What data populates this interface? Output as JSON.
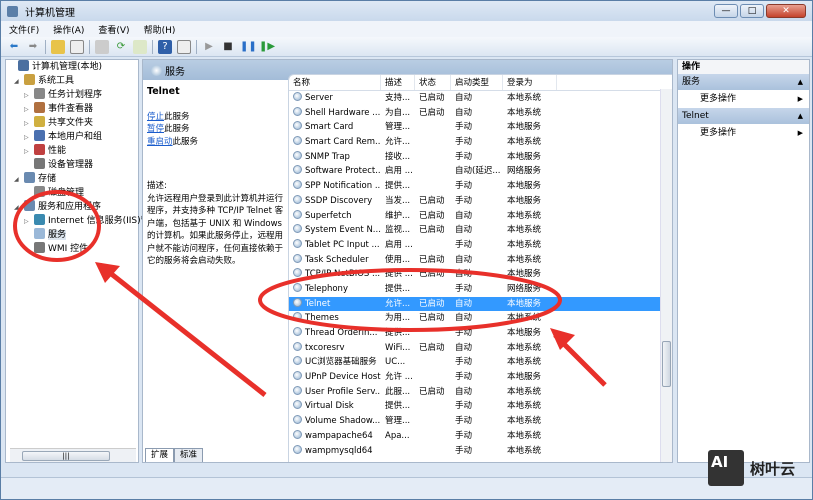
{
  "window": {
    "title": "计算机管理",
    "min": "—",
    "max": "□",
    "close": "✕"
  },
  "menu": [
    "文件(F)",
    "操作(A)",
    "查看(V)",
    "帮助(H)"
  ],
  "tree": [
    {
      "label": "计算机管理(本地)",
      "indent": 0,
      "arrow": ""
    },
    {
      "label": "系统工具",
      "indent": 1,
      "arrow": "◢"
    },
    {
      "label": "任务计划程序",
      "indent": 2,
      "arrow": "▷"
    },
    {
      "label": "事件查看器",
      "indent": 2,
      "arrow": "▷"
    },
    {
      "label": "共享文件夹",
      "indent": 2,
      "arrow": "▷"
    },
    {
      "label": "本地用户和组",
      "indent": 2,
      "arrow": "▷"
    },
    {
      "label": "性能",
      "indent": 2,
      "arrow": "▷"
    },
    {
      "label": "设备管理器",
      "indent": 2,
      "arrow": ""
    },
    {
      "label": "存储",
      "indent": 1,
      "arrow": "◢"
    },
    {
      "label": "磁盘管理",
      "indent": 2,
      "arrow": ""
    },
    {
      "label": "服务和应用程序",
      "indent": 1,
      "arrow": "◢"
    },
    {
      "label": "Internet 信息服务(IIS)管",
      "indent": 2,
      "arrow": "▷"
    },
    {
      "label": "服务",
      "indent": 2,
      "arrow": ""
    },
    {
      "label": "WMI 控件",
      "indent": 2,
      "arrow": ""
    }
  ],
  "middle": {
    "header": "服务",
    "selected_name": "Telnet",
    "links": [
      {
        "link": "停止",
        "rest": "此服务"
      },
      {
        "link": "暂停",
        "rest": "此服务"
      },
      {
        "link": "重启动",
        "rest": "此服务"
      }
    ],
    "desc_label": "描述:",
    "description": "允许远程用户登录到此计算机并运行程序，并支持多种 TCP/IP Telnet 客户端，包括基于 UNIX 和 Windows 的计算机。如果此服务停止，远程用户就不能访问程序，任何直接依赖于它的服务将会启动失败。"
  },
  "columns": [
    "名称",
    "描述",
    "状态",
    "启动类型",
    "登录为"
  ],
  "services": [
    [
      "Server",
      "支持...",
      "已启动",
      "自动",
      "本地系统"
    ],
    [
      "Shell Hardware ...",
      "为自...",
      "已启动",
      "自动",
      "本地系统"
    ],
    [
      "Smart Card",
      "管理...",
      "",
      "手动",
      "本地服务"
    ],
    [
      "Smart Card Rem...",
      "允许...",
      "",
      "手动",
      "本地系统"
    ],
    [
      "SNMP Trap",
      "接收...",
      "",
      "手动",
      "本地服务"
    ],
    [
      "Software Protect...",
      "启用 ...",
      "",
      "自动(延迟...",
      "网络服务"
    ],
    [
      "SPP Notification ...",
      "提供...",
      "",
      "手动",
      "本地服务"
    ],
    [
      "SSDP Discovery",
      "当发...",
      "已启动",
      "手动",
      "本地服务"
    ],
    [
      "Superfetch",
      "维护...",
      "已启动",
      "自动",
      "本地系统"
    ],
    [
      "System Event N...",
      "监视...",
      "已启动",
      "自动",
      "本地系统"
    ],
    [
      "Tablet PC Input ...",
      "启用 ...",
      "",
      "手动",
      "本地系统"
    ],
    [
      "Task Scheduler",
      "使用...",
      "已启动",
      "自动",
      "本地系统"
    ],
    [
      "TCP/IP NetBIOS ...",
      "提供 ...",
      "已启动",
      "自动",
      "本地服务"
    ],
    [
      "Telephony",
      "提供...",
      "",
      "手动",
      "网络服务"
    ],
    [
      "Telnet",
      "允许...",
      "已启动",
      "自动",
      "本地服务"
    ],
    [
      "Themes",
      "为用...",
      "已启动",
      "自动",
      "本地系统"
    ],
    [
      "Thread Orderin...",
      "提供...",
      "",
      "手动",
      "本地服务"
    ],
    [
      "txcoresrv",
      "WiFi...",
      "已启动",
      "自动",
      "本地系统"
    ],
    [
      "UC浏览器基础服务",
      "UC...",
      "",
      "手动",
      "本地系统"
    ],
    [
      "UPnP Device Host",
      "允许 ...",
      "",
      "手动",
      "本地服务"
    ],
    [
      "User Profile Serv...",
      "此服...",
      "已启动",
      "自动",
      "本地系统"
    ],
    [
      "Virtual Disk",
      "提供...",
      "",
      "手动",
      "本地系统"
    ],
    [
      "Volume Shadow...",
      "管理...",
      "",
      "手动",
      "本地系统"
    ],
    [
      "wampapache64",
      "Apa...",
      "",
      "手动",
      "本地系统"
    ],
    [
      "wampmysqld64",
      "",
      "",
      "手动",
      "本地系统"
    ]
  ],
  "selected_index": 14,
  "tabs": [
    "扩展",
    "标准"
  ],
  "actions": {
    "title": "操作",
    "sections": [
      {
        "name": "服务",
        "item": "更多操作"
      },
      {
        "name": "Telnet",
        "item": "更多操作"
      }
    ]
  },
  "watermark": {
    "logo": "AI",
    "text": "树叶云"
  },
  "colors": {
    "selection": "#3399ff",
    "annotation": "#e8302a",
    "header": "#a3bcd8"
  }
}
